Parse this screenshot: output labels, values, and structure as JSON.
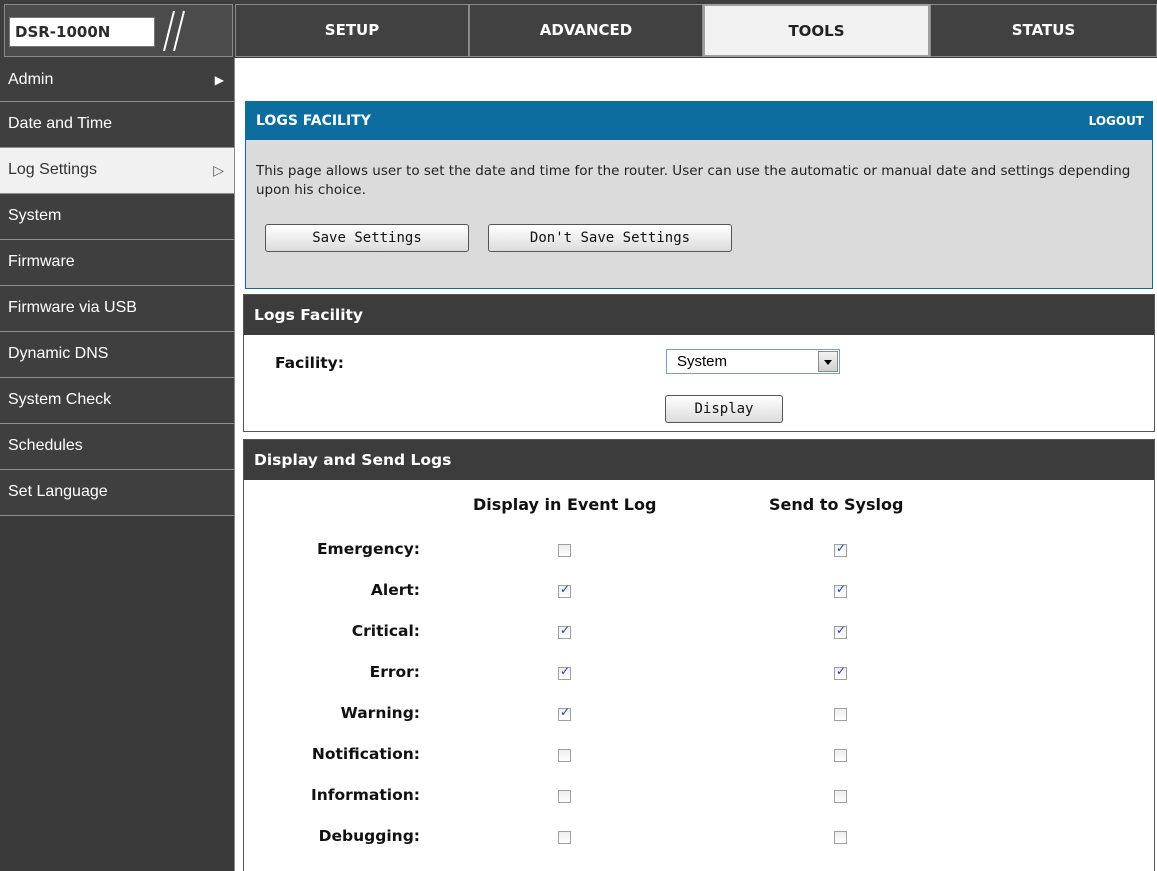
{
  "model": "DSR-1000N",
  "nav": {
    "tabs": [
      {
        "label": "SETUP"
      },
      {
        "label": "ADVANCED"
      },
      {
        "label": "TOOLS"
      },
      {
        "label": "STATUS"
      }
    ]
  },
  "sidebar": {
    "items": [
      {
        "label": "Admin"
      },
      {
        "label": "Date and Time"
      },
      {
        "label": "Log Settings"
      },
      {
        "label": "System"
      },
      {
        "label": "Firmware"
      },
      {
        "label": "Firmware via USB"
      },
      {
        "label": "Dynamic DNS"
      },
      {
        "label": "System Check"
      },
      {
        "label": "Schedules"
      },
      {
        "label": "Set Language"
      }
    ]
  },
  "intro": {
    "title": "LOGS FACILITY",
    "logout": "LOGOUT",
    "description": "This page allows user to set the date and time for the router. User can use the automatic or manual date and settings depending upon his choice.",
    "save_label": "Save Settings",
    "dont_save_label": "Don't Save Settings"
  },
  "facility": {
    "title": "Logs Facility",
    "label": "Facility:",
    "selected": "System",
    "display_label": "Display"
  },
  "logs": {
    "title": "Display and Send Logs",
    "col_display": "Display in Event Log",
    "col_syslog": "Send to Syslog",
    "rows": [
      {
        "label": "Emergency:",
        "display": false,
        "syslog": true
      },
      {
        "label": "Alert:",
        "display": true,
        "syslog": true
      },
      {
        "label": "Critical:",
        "display": true,
        "syslog": true
      },
      {
        "label": "Error:",
        "display": true,
        "syslog": true
      },
      {
        "label": "Warning:",
        "display": true,
        "syslog": false
      },
      {
        "label": "Notification:",
        "display": false,
        "syslog": false
      },
      {
        "label": "Information:",
        "display": false,
        "syslog": false
      },
      {
        "label": "Debugging:",
        "display": false,
        "syslog": false
      }
    ]
  }
}
